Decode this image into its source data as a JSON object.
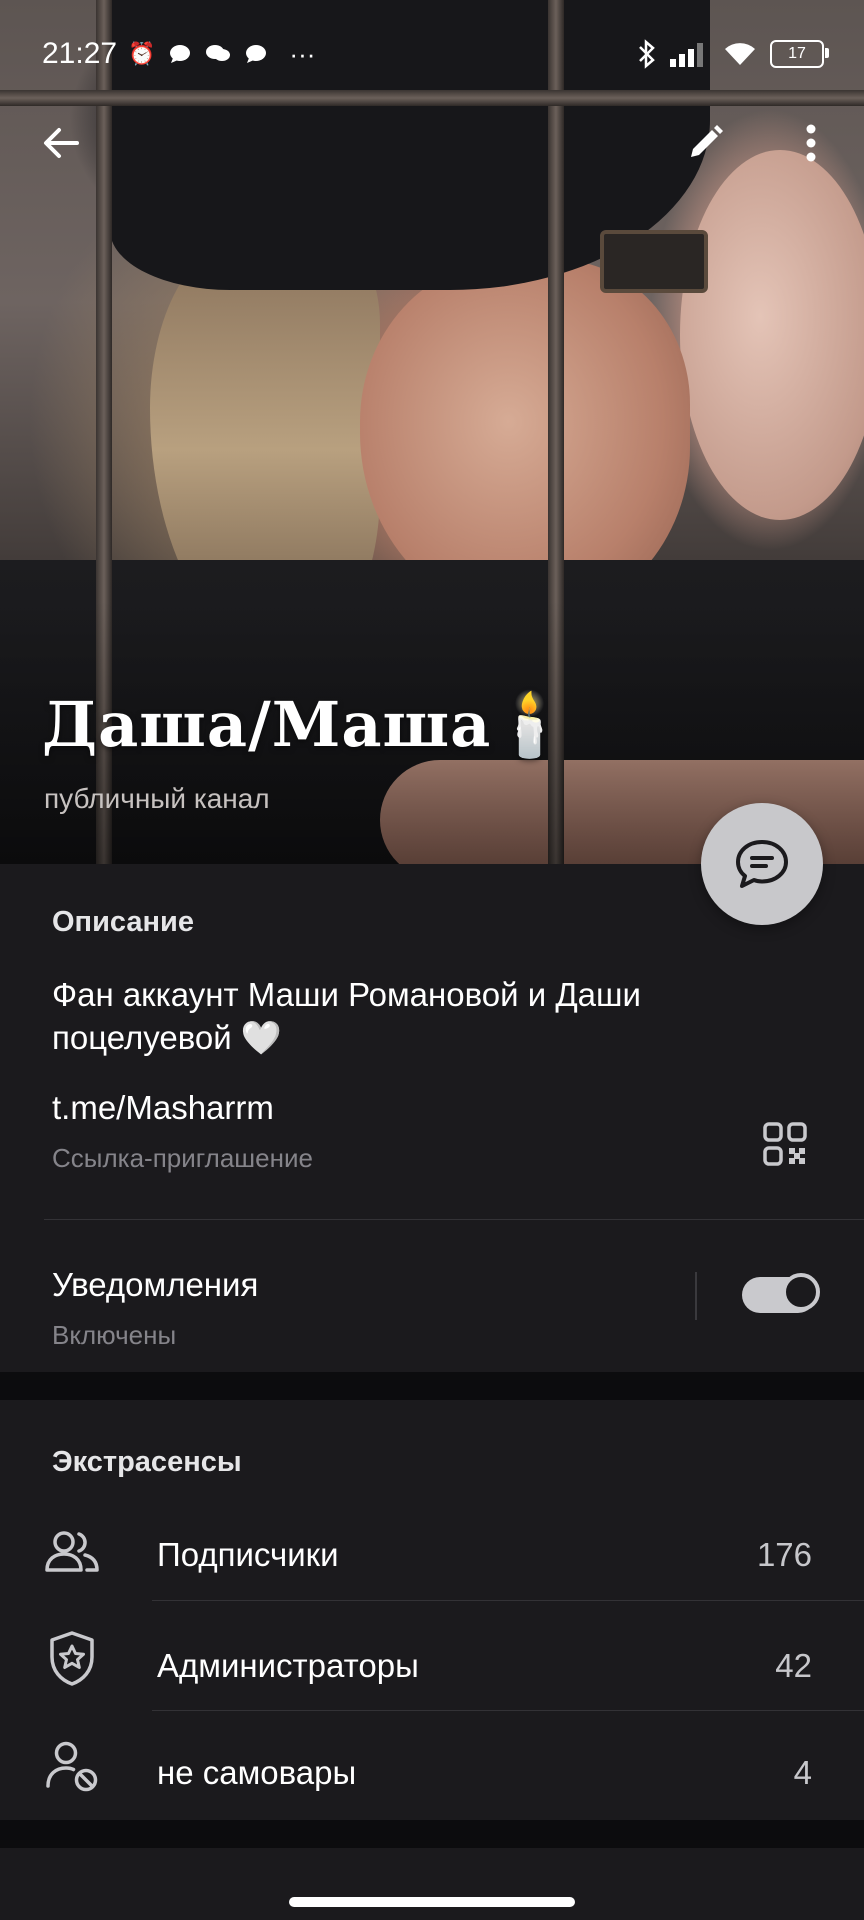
{
  "status_bar": {
    "time": "21:27",
    "overflow": "···",
    "battery": "17"
  },
  "header": {
    "title": "Даша/Маша🕯️",
    "subtitle": "публичный канал"
  },
  "description": {
    "heading": "Описание",
    "text_line1": "Фан аккаунт Маши Романовой и Даши",
    "text_line2": "поцелуевой 🤍",
    "link": "t.me/Masharrm",
    "link_caption": "Ссылка-приглашение"
  },
  "notifications": {
    "label": "Уведомления",
    "state": "Включены",
    "enabled": true
  },
  "members": {
    "heading": "Экстрасенсы",
    "items": [
      {
        "label": "Подписчики",
        "count": "176",
        "icon": "people-icon"
      },
      {
        "label": "Администраторы",
        "count": "42",
        "icon": "shield-star-icon"
      },
      {
        "label": "не самовары",
        "count": "4",
        "icon": "user-blocked-icon"
      }
    ]
  },
  "colors": {
    "background": "#0c0c0e",
    "card": "#1b1a1d",
    "muted_text": "#85848a",
    "fab": "#c8c8cb"
  }
}
